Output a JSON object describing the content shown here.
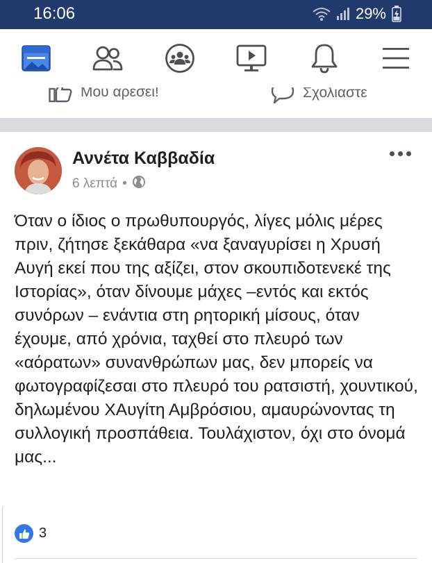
{
  "status_bar": {
    "time": "16:06",
    "battery": "29%",
    "icons": [
      "wifi-icon",
      "signal-icon",
      "battery-charging-icon"
    ]
  },
  "nav": {
    "items": [
      {
        "name": "news-feed",
        "icon": "news-feed-icon",
        "active": true
      },
      {
        "name": "friends",
        "icon": "friends-icon",
        "active": false
      },
      {
        "name": "groups",
        "icon": "groups-icon",
        "active": false
      },
      {
        "name": "watch",
        "icon": "watch-icon",
        "active": false
      },
      {
        "name": "notifications",
        "icon": "bell-icon",
        "active": false
      },
      {
        "name": "menu",
        "icon": "hamburger-icon",
        "active": false
      }
    ],
    "active_color": "#1877f2",
    "icon_color": "#4b4f56"
  },
  "prev_post": {
    "like_label": "Μου αρεσει!",
    "comment_label": "Σχολιαστε"
  },
  "post": {
    "author": "Αννέτα Καββαδία",
    "time": "6 λεπτά",
    "separator": "•",
    "privacy_icon": "globe-icon",
    "text": "Όταν ο ίδιος ο πρωθυπουργός, λίγες μόλις μέρες πριν, ζήτησε ξεκάθαρα «να ξαναγυρίσει η Χρυσή Αυγή εκεί που της αξίζει, στον σκουπιδοτενεκέ της Ιστορίας», όταν δίνουμε μάχες –εντός και εκτός συνόρων – ενάντια στη ρητορική μίσους, όταν έχουμε, από χρόνια, ταχθεί στο πλευρό των «αόρατων» συναν­θρώπων μας, δεν μπορείς να φωτογραφίζεσαι στο πλευρό του ρατσιστή, χουντικού, δηλωμένου ΧΑυγίτη Αμβρόσιου, αμαυρώνοντας τη συλλογική προσπάθεια. Τουλάχιστον, όχι στο όνομά μας...",
    "likes_count": "3"
  }
}
